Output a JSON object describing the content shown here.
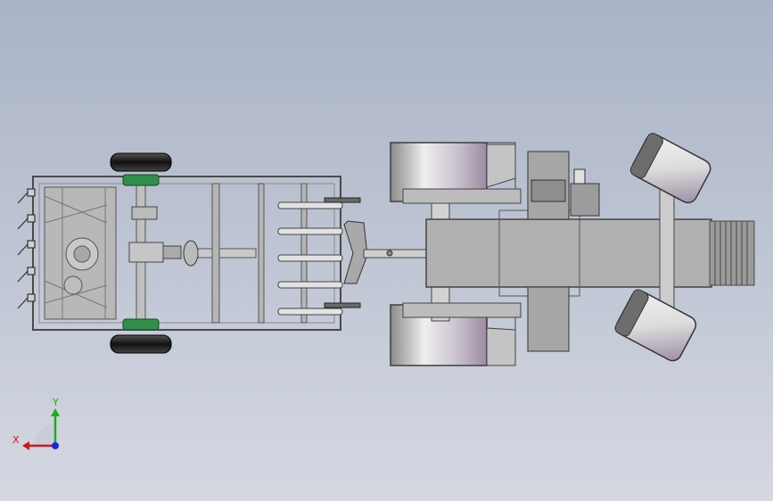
{
  "viewport": {
    "background_top": "#aab4c7",
    "background_bottom": "#d4d8e1"
  },
  "triad": {
    "x_label": "X",
    "y_label": "Y",
    "x_color": "#d01818",
    "y_color": "#18b018",
    "z_color": "#1828d8"
  },
  "palette": {
    "frame": "#8a8a8a",
    "frame_dark": "#4a4a4a",
    "tire": "#1e1e1e",
    "bearing": "#2f8f4a",
    "body": "#b4b4b4",
    "wheel_highlight": "#f0f0f0",
    "wheel_tint": "#a894ac"
  }
}
